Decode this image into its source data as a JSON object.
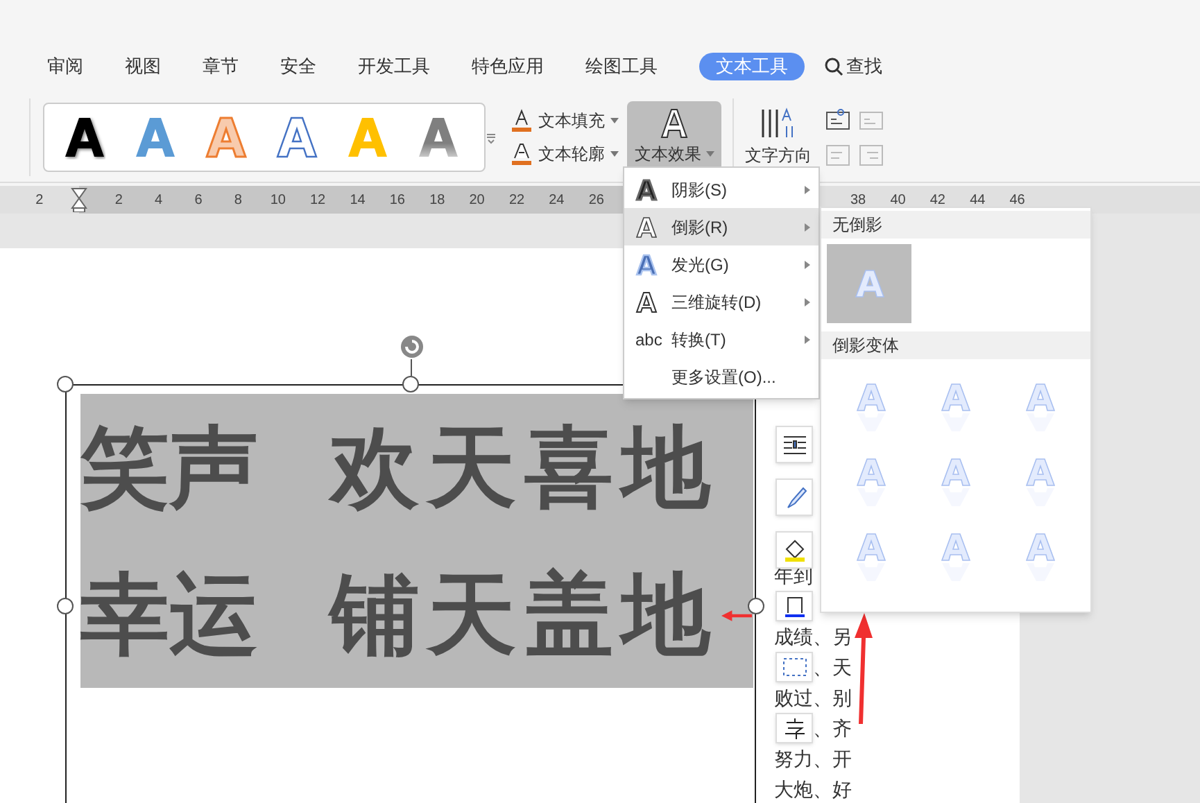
{
  "tabs": [
    {
      "label": "审阅",
      "selected": false
    },
    {
      "label": "视图",
      "selected": false
    },
    {
      "label": "章节",
      "selected": false
    },
    {
      "label": "安全",
      "selected": false
    },
    {
      "label": "开发工具",
      "selected": false
    },
    {
      "label": "特色应用",
      "selected": false
    },
    {
      "label": "绘图工具",
      "selected": false
    },
    {
      "label": "文本工具",
      "selected": true
    }
  ],
  "search_label": "查找",
  "style_gallery": [
    {
      "kind": "shadow",
      "color": "#000000"
    },
    {
      "kind": "solid",
      "color": "#5b9bd5"
    },
    {
      "kind": "outline-fill",
      "color": "#ed7d31"
    },
    {
      "kind": "outline",
      "color": "#4472c4"
    },
    {
      "kind": "solid",
      "color": "#ffc000"
    },
    {
      "kind": "gradient",
      "color": "#7f7f7f"
    }
  ],
  "format_commands": [
    {
      "label": "文本填充",
      "kind": "fill"
    },
    {
      "label": "文本轮廓",
      "kind": "outline"
    }
  ],
  "text_effects": {
    "label": "文本效果",
    "pressed": true
  },
  "text_direction": "文字方向",
  "ruler": {
    "left_ticks": [
      "2"
    ],
    "ticks": [
      "2",
      "4",
      "6",
      "8",
      "10",
      "12",
      "14",
      "16",
      "18",
      "20",
      "22",
      "24",
      "26"
    ],
    "right_ticks": [
      "38",
      "40",
      "42",
      "44",
      "46"
    ]
  },
  "effects_menu": [
    {
      "label": "阴影(S)",
      "kind": "shadow",
      "selected": false,
      "submenu": true
    },
    {
      "label": "倒影(R)",
      "kind": "reflection",
      "selected": true,
      "submenu": true
    },
    {
      "label": "发光(G)",
      "kind": "glow",
      "selected": false,
      "submenu": true
    },
    {
      "label": "三维旋转(D)",
      "kind": "rotate3d",
      "selected": false,
      "submenu": true
    },
    {
      "label": "转换(T)",
      "kind": "transform",
      "icon_text": "abc",
      "selected": false,
      "submenu": true
    },
    {
      "label": "更多设置(O)...",
      "kind": "plain",
      "selected": false,
      "submenu": false
    }
  ],
  "reflection_submenu": [
    {
      "title": "无倒影",
      "kind": "none",
      "options": [
        {
          "selected": true
        }
      ]
    },
    {
      "title": "倒影变体",
      "kind": "variant",
      "options": [
        {
          "selected": false
        },
        {
          "selected": false
        },
        {
          "selected": false
        },
        {
          "selected": false
        },
        {
          "selected": false
        },
        {
          "selected": false
        },
        {
          "selected": false
        },
        {
          "selected": false
        },
        {
          "selected": false
        }
      ]
    }
  ],
  "textbox_lines": [
    [
      "笑声",
      "欢天喜地"
    ],
    [
      "幸运",
      "铺天盖地"
    ]
  ],
  "body_lines": [
    {
      "kind": "left",
      "text": "年到"
    },
    {
      "kind": "covered"
    },
    {
      "kind": "full",
      "text": "成绩、另"
    },
    {
      "kind": "right",
      "text": "、天"
    },
    {
      "kind": "full",
      "text": "败过、别"
    },
    {
      "kind": "right",
      "text": "、齐"
    },
    {
      "kind": "full",
      "text": "努力、开"
    },
    {
      "kind": "full",
      "text": "大炮、好"
    }
  ]
}
